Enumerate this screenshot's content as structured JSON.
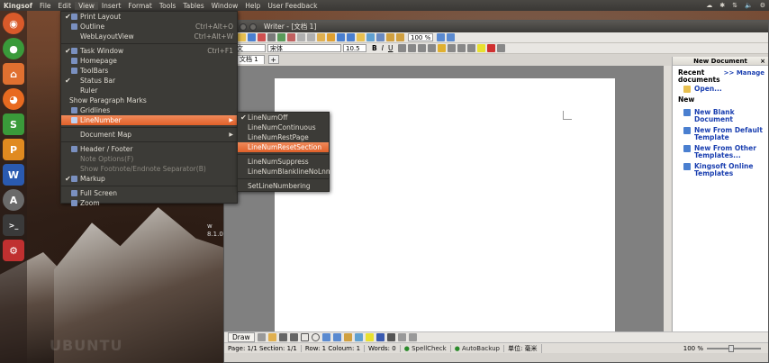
{
  "top_panel": {
    "app_title": "Kingsof",
    "menus": [
      "File",
      "Edit",
      "View",
      "Insert",
      "Format",
      "Tools",
      "Tables",
      "Window",
      "Help",
      "User Feedback"
    ],
    "active_menu": "View",
    "tray_time": ""
  },
  "launcher": [
    {
      "name": "ubuntu-icon",
      "glyph": "◉",
      "color": "#d95a2a"
    },
    {
      "name": "chrome-icon",
      "glyph": "●",
      "color": "#3a9a3a"
    },
    {
      "name": "home-folder-icon",
      "glyph": "⌂",
      "color": "#e07030"
    },
    {
      "name": "firefox-icon",
      "glyph": "◕",
      "color": "#e86a20"
    },
    {
      "name": "spreadsheet-icon",
      "glyph": "S",
      "color": "#3a9a3a"
    },
    {
      "name": "presentation-icon",
      "glyph": "P",
      "color": "#e08a20"
    },
    {
      "name": "writer-icon",
      "glyph": "W",
      "color": "#2a5ab0"
    },
    {
      "name": "software-center-icon",
      "glyph": "A",
      "color": "#6a6a6a"
    },
    {
      "name": "terminal-icon",
      "glyph": ">_",
      "color": "#3a3a3a"
    },
    {
      "name": "settings-icon",
      "glyph": "⚙",
      "color": "#c03030"
    }
  ],
  "desktop": {
    "watermark": "UBUNTU",
    "version_line1": "w",
    "version_line2": "8.1.0"
  },
  "window": {
    "title": "Writer - [文档 1]",
    "zoom": "100 %",
    "style": "正文",
    "font": "宋体",
    "size": "10.5",
    "tab_label": "文档 1",
    "tab_add": "+"
  },
  "task_pane": {
    "header": "New Document",
    "close": "×",
    "recent_label": "Recent documents",
    "manage_label": ">> Manage",
    "open_label": "Open...",
    "new_label": "New",
    "links": [
      "New Blank Document",
      "New From Default Template",
      "New From Other Templates...",
      "Kingsoft Online Templates"
    ]
  },
  "drawbar": {
    "draw_label": "Draw"
  },
  "statusbar": {
    "page": "Page: 1/1 Section: 1/1",
    "row": "Row: 1 Coloum: 1",
    "words": "Words: 0",
    "spellcheck": "SpellCheck",
    "autobackup": "AutoBackup",
    "unit": "单位: 毫米",
    "zoom": "100 %"
  },
  "view_menu": {
    "items": [
      {
        "label": "Print Layout",
        "checked": true,
        "icon": true,
        "shortcut": ""
      },
      {
        "label": "Outline",
        "checked": false,
        "icon": true,
        "shortcut": "Ctrl+Alt+O"
      },
      {
        "label": "WebLayoutView",
        "checked": false,
        "icon": false,
        "shortcut": "Ctrl+Alt+W"
      },
      {
        "label": "Task Window",
        "checked": true,
        "icon": true,
        "shortcut": "Ctrl+F1"
      },
      {
        "label": "Homepage",
        "checked": false,
        "icon": true,
        "shortcut": ""
      },
      {
        "label": "ToolBars",
        "checked": false,
        "icon": true,
        "shortcut": ""
      },
      {
        "label": "Status Bar",
        "checked": true,
        "icon": false,
        "shortcut": ""
      },
      {
        "label": "Ruler",
        "checked": false,
        "icon": false,
        "shortcut": ""
      },
      {
        "label": "Show Paragraph Marks",
        "checked": false,
        "icon": false,
        "shortcut": ""
      },
      {
        "label": "Gridlines",
        "checked": false,
        "icon": true,
        "shortcut": ""
      },
      {
        "label": "LineNumber",
        "checked": false,
        "icon": true,
        "shortcut": "",
        "highlight": true,
        "submenu": true
      },
      {
        "label": "Document Map",
        "checked": false,
        "icon": false,
        "shortcut": "",
        "submenu": true
      },
      {
        "label": "Header / Footer",
        "checked": false,
        "icon": true,
        "shortcut": ""
      },
      {
        "label": "Note Options(F)",
        "checked": false,
        "icon": false,
        "shortcut": "",
        "disabled": true
      },
      {
        "label": "Show Footnote/Endnote Separator(B)",
        "checked": false,
        "icon": false,
        "shortcut": "",
        "disabled": true
      },
      {
        "label": "Markup",
        "checked": true,
        "icon": true,
        "shortcut": ""
      },
      {
        "label": "Full Screen",
        "checked": false,
        "icon": true,
        "shortcut": ""
      },
      {
        "label": "Zoom",
        "checked": false,
        "icon": true,
        "shortcut": ""
      }
    ]
  },
  "line_number_menu": {
    "items": [
      {
        "label": "LineNumOff",
        "checked": true
      },
      {
        "label": "LineNumContinuous",
        "checked": false
      },
      {
        "label": "LineNumRestPage",
        "checked": false
      },
      {
        "label": "LineNumResetSection",
        "checked": false,
        "highlight": true
      },
      {
        "label": "LineNumSuppress",
        "checked": false
      },
      {
        "label": "LineNumBlanklineNoLnn",
        "checked": false
      },
      {
        "label": "SetLineNumbering",
        "checked": false
      }
    ]
  }
}
